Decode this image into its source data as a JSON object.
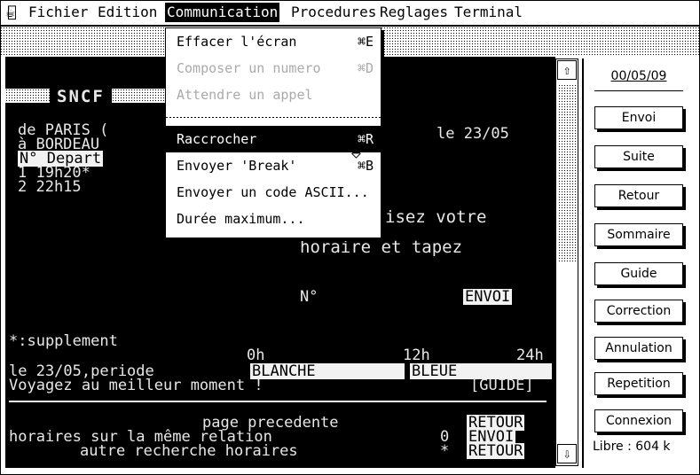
{
  "menubar": {
    "apple_icon": "apple-icon",
    "items": [
      "Fichier",
      "Edition",
      "Communication",
      "Procedures",
      "Reglages",
      "Terminal"
    ],
    "active": "Communication"
  },
  "menu": {
    "items": [
      {
        "label": "Effacer l'écran",
        "key": "⌘E",
        "disabled": false,
        "highlighted": false
      },
      {
        "label": "Composer un numero",
        "key": "⌘D",
        "disabled": true,
        "highlighted": false
      },
      {
        "label": "Attendre un appel",
        "key": "",
        "disabled": true,
        "highlighted": false
      },
      {
        "label": "Raccrocher",
        "key": "⌘R",
        "disabled": false,
        "highlighted": true
      },
      {
        "label": "Envoyer 'Break'",
        "key": "⌘B",
        "disabled": false,
        "highlighted": false
      },
      {
        "label": "Envoyer un code ASCII...",
        "key": "",
        "disabled": false,
        "highlighted": false
      },
      {
        "label": "Durée maximum...",
        "key": "",
        "disabled": false,
        "highlighted": false
      }
    ]
  },
  "terminal": {
    "brand": "SNCF",
    "route_from": "de PARIS (",
    "route_to": "à  BORDEAU",
    "date": "le 23/05",
    "header": "N° Depart",
    "row1": "1  19h20*",
    "row2": "2  22h15",
    "prompt1": "isez votre",
    "prompt2": "horaire et tapez",
    "num_label": "N°",
    "envoi": "ENVOI",
    "supplement": "*:supplement",
    "period_line": "le 23/05,periode",
    "hour_0": "0h",
    "hour_12": "12h",
    "hour_24": "24h",
    "blanche": "BLANCHE",
    "bleue": "BLEUE",
    "advice": "Voyagez au meilleur moment !",
    "guide_key": "[GUIDE]",
    "prev_page": "page precedente",
    "same_rel": "horaires sur la même relation",
    "other": "autre recherche horaires",
    "same_rel_num": "0",
    "other_sym": "*",
    "retour": "RETOUR",
    "envoi2": "ENVOI",
    "retour2": "RETOUR"
  },
  "panel": {
    "date": "00/05/09",
    "buttons": [
      "Envoi",
      "Suite",
      "Retour",
      "Sommaire",
      "Guide",
      "Correction",
      "Annulation",
      "Repetition",
      "Connexion"
    ],
    "free": "Libre : 604 k"
  }
}
